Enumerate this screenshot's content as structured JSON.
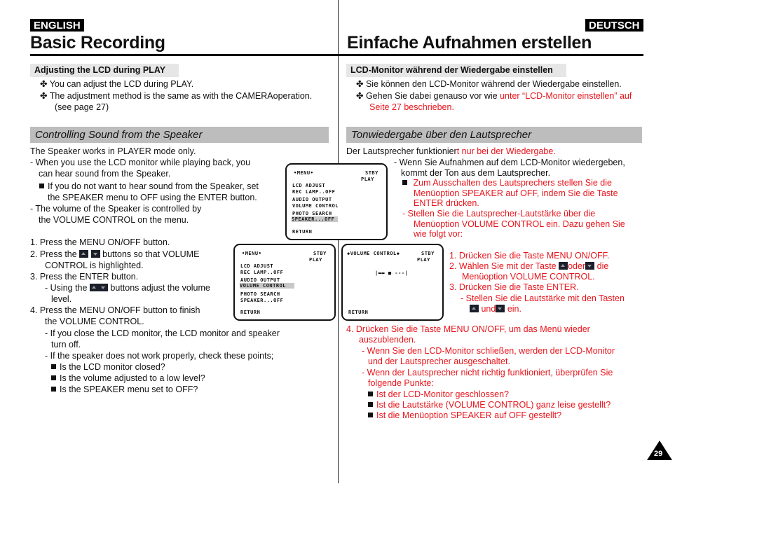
{
  "header": {
    "lang_en": "ENGLISH",
    "lang_de": "DEUTSCH",
    "title_en": "Basic Recording",
    "title_de": "Einfache Aufnahmen erstellen"
  },
  "en": {
    "lcd_heading": "Adjusting the LCD during PLAY",
    "lcd_items": [
      "You can adjust the LCD during PLAY.",
      "The adjustment method is the same as with the CAMERAoperation.",
      "(see page 27)"
    ],
    "speaker_heading": "Controlling Sound from the Speaker",
    "intro": "The Speaker works in PLAYER mode only.",
    "p1a": "- When you use the LCD monitor while playing back, you",
    "p1b": "can hear sound from the Speaker.",
    "p2a": "If you do not want to hear sound from the Speaker, set",
    "p2b": "the SPEAKER menu to OFF using the ENTER button.",
    "p3a": "- The volume of the Speaker is controlled by",
    "p3b": "the VOLUME CONTROL on the menu.",
    "step1": "1.  Press the MENU ON/OFF button.",
    "step2a": "2.  Press the",
    "step2b": "buttons so that VOLUME",
    "step2c": "CONTROL is highlighted.",
    "step3": "3.  Press the ENTER button.",
    "step3a": "- Using the",
    "step3b": "buttons adjust the volume",
    "step3c": "level.",
    "step4a": "4.  Press the MENU ON/OFF button to finish",
    "step4b": "the VOLUME CONTROL.",
    "note1a": "- If you close the LCD monitor, the LCD monitor and speaker",
    "note1b": "turn off.",
    "note2": "- If the speaker does not work properly, check these points;",
    "checks": [
      "Is the LCD monitor closed?",
      "Is the volume adjusted to a low level?",
      "Is the SPEAKER menu set to OFF?"
    ]
  },
  "de": {
    "lcd_heading": "LCD-Monitor während der Wiedergabe einstellen",
    "lcd_item1": "Sie können den LCD-Monitor während der Wiedergabe einstellen.",
    "lcd_item2_black": "Gehen Sie dabei genauso vor wie ",
    "lcd_item2_red": "unter “LCD-Monitor einstellen” auf",
    "lcd_item2_red2": "Seite 27 beschrieben.",
    "speaker_heading": "Tonwiedergabe über den Lautsprecher",
    "intro_black": "Der Lautsprecher funktionier",
    "intro_red": "t nur bei der Wiedergabe.",
    "p1a": "- Wenn Sie Aufnahmen auf dem LCD-Monitor wiedergeben,",
    "p1b": "kommt der Ton aus dem Lautsprecher.",
    "p2a": "Zum Ausschalten des Lautsprechers stellen Sie die",
    "p2b": "Menüoption SPEAKER auf OFF, indem Sie die Taste",
    "p2c": "ENTER drücken.",
    "p3a": "-   Stellen Sie die Lautsprecher-Lautstärke über die",
    "p3b": "Menüoption VOLUME CONTROL ein. Dazu gehen Sie",
    "p3c": "wie folgt vor:",
    "step1": "1.  Drücken Sie die Taste MENU ON/OFF.",
    "step2a": "2.  Wählen Sie mit der Taste",
    "step2b": "oder",
    "step2c": "die",
    "step2d": "Menüoption VOLUME CONTROL.",
    "step3": "3.  Drücken Sie die Taste ENTER.",
    "step3a": "- Stellen Sie die Lautstärke mit den Tasten",
    "step3b": "und",
    "step3c": "ein.",
    "step4a": "4.  Drücken Sie die Taste MENU ON/OFF, um das Menü wieder",
    "step4b": "auszublenden.",
    "note1a": "- Wenn Sie den LCD-Monitor schließen, werden der LCD-Monitor",
    "note1b": "und der Lautsprecher ausgeschaltet.",
    "note2a": "- Wenn der Lautsprecher nicht richtig funktioniert, überprüfen Sie",
    "note2b": "folgende Punkte:",
    "checks": [
      "Ist der LCD-Monitor geschlossen?",
      "Ist die Lautstärke (VOLUME CONTROL) ganz leise gestellt?",
      "Ist die Menüoption SPEAKER auf OFF gestellt?"
    ]
  },
  "lcd_screens": {
    "menu_title": "•MENU•",
    "status1": "STBY",
    "status2": "PLAY",
    "items": [
      "LCD ADJUST",
      "REC LAMP..OFF",
      "AUDIO OUTPUT",
      "VOLUME CONTROL",
      "PHOTO SEARCH",
      "SPEAKER...OFF"
    ],
    "return": "RETURN",
    "vol_title": "◆VOLUME CONTROL◆",
    "vol_bar": "|▬▬ ■ ---|"
  },
  "page_number": "29",
  "colors": {
    "accent_red": "#e8141b",
    "section_gray": "#bdbdbd",
    "subsection_gray": "#e6e6e6"
  }
}
